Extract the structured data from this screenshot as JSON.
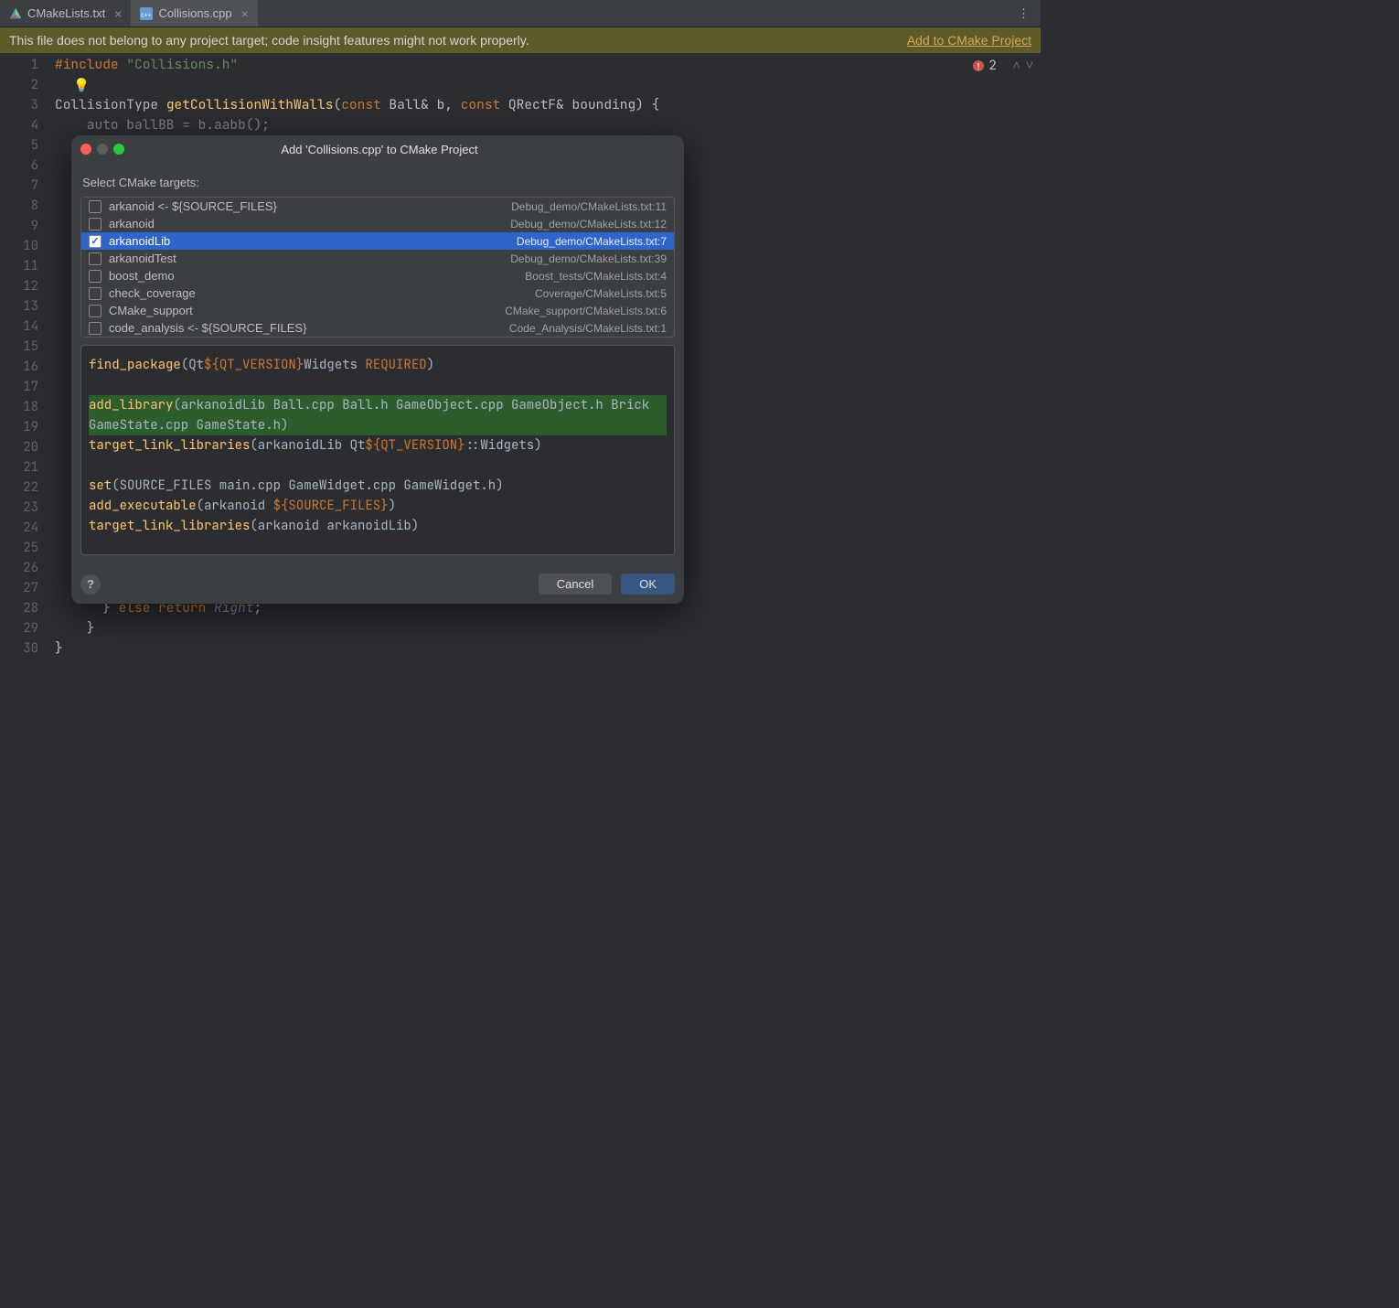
{
  "tabs": [
    {
      "label": "CMakeLists.txt",
      "active": false,
      "icon": "cmake"
    },
    {
      "label": "Collisions.cpp",
      "active": true,
      "icon": "cpp"
    }
  ],
  "warning": {
    "text": "This file does not belong to any project target; code insight features might not work properly.",
    "link": "Add to CMake Project"
  },
  "error_count": "2",
  "code_lines": [
    "1",
    "2",
    "3",
    "4",
    "5",
    "6",
    "7",
    "8",
    "9",
    "10",
    "11",
    "12",
    "13",
    "14",
    "15",
    "16",
    "17",
    "18",
    "19",
    "20",
    "21",
    "22",
    "23",
    "24",
    "25",
    "26",
    "27",
    "28",
    "29",
    "30"
  ],
  "code": {
    "l1_dir": "#include ",
    "l1_str": "\"Collisions.h\"",
    "l3_a": "CollisionType ",
    "l3_fn": "getCollisionWithWalls",
    "l3_b": "(",
    "l3_kw1": "const",
    "l3_c": " Ball& ",
    "l3_p1": "b",
    "l3_d": ", ",
    "l3_kw2": "const",
    "l3_e": " QRectF& ",
    "l3_p2": "bounding",
    "l3_f": ") {",
    "l4": "    auto ballBB = b.aabb();",
    "l28_a": "      } ",
    "l28_kw": "else return ",
    "l28_v": "Right",
    "l28_b": ";",
    "l29": "    }",
    "l30": "}"
  },
  "dialog": {
    "title": "Add 'Collisions.cpp' to CMake Project",
    "label": "Select CMake targets:",
    "targets": [
      {
        "name": "arkanoid <- ${SOURCE_FILES}",
        "path": "Debug_demo/CMakeLists.txt:11",
        "checked": false,
        "selected": false
      },
      {
        "name": "arkanoid",
        "path": "Debug_demo/CMakeLists.txt:12",
        "checked": false,
        "selected": false
      },
      {
        "name": "arkanoidLib",
        "path": "Debug_demo/CMakeLists.txt:7",
        "checked": true,
        "selected": true
      },
      {
        "name": "arkanoidTest",
        "path": "Debug_demo/CMakeLists.txt:39",
        "checked": false,
        "selected": false
      },
      {
        "name": "boost_demo",
        "path": "Boost_tests/CMakeLists.txt:4",
        "checked": false,
        "selected": false
      },
      {
        "name": "check_coverage",
        "path": "Coverage/CMakeLists.txt:5",
        "checked": false,
        "selected": false
      },
      {
        "name": "CMake_support",
        "path": "CMake_support/CMakeLists.txt:6",
        "checked": false,
        "selected": false
      },
      {
        "name": "code_analysis <- ${SOURCE_FILES}",
        "path": "Code_Analysis/CMakeLists.txt:1",
        "checked": false,
        "selected": false
      }
    ],
    "preview": {
      "l1a": "find_package",
      "l1b": "(Qt",
      "l1c": "${QT_VERSION}",
      "l1d": "Widgets ",
      "l1e": "REQUIRED",
      "l1f": ")",
      "l3a": "add_library",
      "l3b": "(arkanoidLib Ball.cpp Ball.h GameObject.cpp GameObject.h Brick",
      "l4": "        GameState.cpp GameState.h)",
      "l5a": "target_link_libraries",
      "l5b": "(arkanoidLib Qt",
      "l5c": "${QT_VERSION}",
      "l5d": "::Widgets)",
      "l7a": "set",
      "l7b": "(SOURCE_FILES main.cpp GameWidget.cpp GameWidget.h)",
      "l8a": "add_executable",
      "l8b": "(arkanoid ",
      "l8c": "${SOURCE_FILES}",
      "l8d": ")",
      "l9a": "target_link_libraries",
      "l9b": "(arkanoid arkanoidLib)"
    },
    "help": "?",
    "cancel": "Cancel",
    "ok": "OK"
  }
}
